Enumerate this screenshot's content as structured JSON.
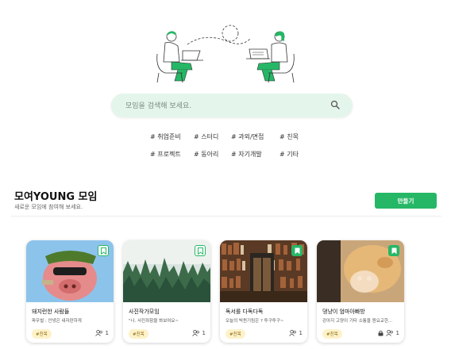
{
  "search": {
    "placeholder": "모임을 검색해 보세요."
  },
  "tags": [
    "# 취업준비",
    "# 스터디",
    "# 과외/면접",
    "# 친목",
    "# 프로젝트",
    "# 동아리",
    "# 자기개발",
    "# 기타"
  ],
  "section": {
    "title": "모여YOUNG 모임",
    "subtitle": "새로운 모임에 참여해 보세요.",
    "create_label": "만들기"
  },
  "cards": [
    {
      "title": "돼지런한 사람들",
      "desc": "파우벌 : 안녕은 내자란하게",
      "badge": "#친목",
      "members": "1",
      "bookmarked": false,
      "locked": false
    },
    {
      "title": "사진작가모임",
      "desc": "\"나. 사진좌함을 봐보여요~",
      "badge": "#친목",
      "members": "1",
      "bookmarked": false,
      "locked": false
    },
    {
      "title": "독서를 다독다독",
      "desc": "오늘의 빅퀸기림은 ? 투구투구~",
      "badge": "#친목",
      "members": "1",
      "bookmarked": true,
      "locked": false
    },
    {
      "title": "댕냥이 엄마아빠방",
      "desc": "강아지 고양이 기타 소통을 원요교한...",
      "badge": "#친목",
      "members": "1",
      "bookmarked": true,
      "locked": true
    }
  ],
  "colors": {
    "accent": "#26b766",
    "search_bg": "#e4f5ec",
    "badge_bg": "#fdf2c8"
  }
}
